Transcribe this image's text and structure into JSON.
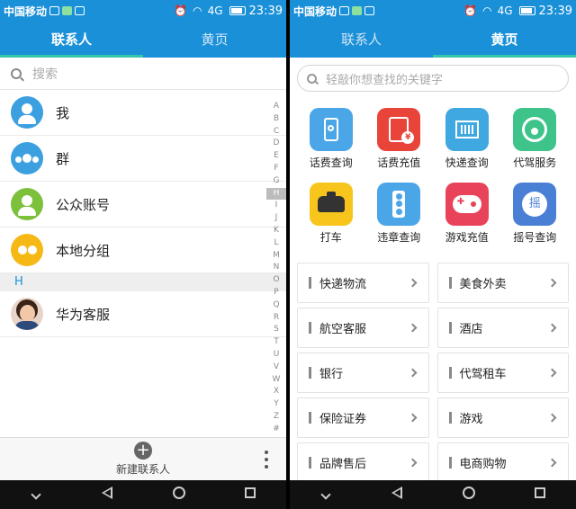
{
  "status": {
    "carrier": "中国移动",
    "signal": "4G",
    "time": "23:39"
  },
  "left": {
    "tabs": [
      {
        "label": "联系人",
        "active": true
      },
      {
        "label": "黄页",
        "active": false
      }
    ],
    "search_placeholder": "搜索",
    "contacts": [
      {
        "name": "我",
        "avatar": "person-icon"
      },
      {
        "name": "群",
        "avatar": "group-icon"
      },
      {
        "name": "公众账号",
        "avatar": "verified-account-icon"
      },
      {
        "name": "本地分组",
        "avatar": "local-group-icon"
      }
    ],
    "section_letter": "H",
    "section_contacts": [
      {
        "name": "华为客服",
        "avatar": "customer-service-avatar"
      }
    ],
    "alpha_index": [
      "A",
      "B",
      "C",
      "D",
      "E",
      "F",
      "G",
      "H",
      "I",
      "J",
      "K",
      "L",
      "M",
      "N",
      "O",
      "P",
      "Q",
      "R",
      "S",
      "T",
      "U",
      "V",
      "W",
      "X",
      "Y",
      "Z",
      "#"
    ],
    "alpha_selected": "H",
    "new_contact_label": "新建联系人"
  },
  "right": {
    "tabs": [
      {
        "label": "联系人",
        "active": false
      },
      {
        "label": "黄页",
        "active": true
      }
    ],
    "search_placeholder": "轻敲你想查找的关键字",
    "services": [
      {
        "label": "话费查询",
        "icon": "phone-search-icon",
        "color": "#4ba6e8"
      },
      {
        "label": "话费充值",
        "icon": "phone-recharge-icon",
        "color": "#e8443a"
      },
      {
        "label": "快递查询",
        "icon": "express-search-icon",
        "color": "#3fa8e0"
      },
      {
        "label": "代驾服务",
        "icon": "steering-wheel-icon",
        "color": "#3ec48a"
      },
      {
        "label": "打车",
        "icon": "taxi-icon",
        "color": "#f8c51c"
      },
      {
        "label": "违章查询",
        "icon": "traffic-light-icon",
        "color": "#4ba6e8"
      },
      {
        "label": "游戏充值",
        "icon": "gamepad-icon",
        "color": "#e8435a"
      },
      {
        "label": "摇号查询",
        "icon": "lottery-shake-icon",
        "color": "#4a7fd6"
      }
    ],
    "shake_glyph": "摇",
    "categories": [
      "快递物流",
      "美食外卖",
      "航空客服",
      "酒店",
      "银行",
      "代驾租车",
      "保险证券",
      "游戏",
      "品牌售后",
      "电商购物"
    ]
  }
}
